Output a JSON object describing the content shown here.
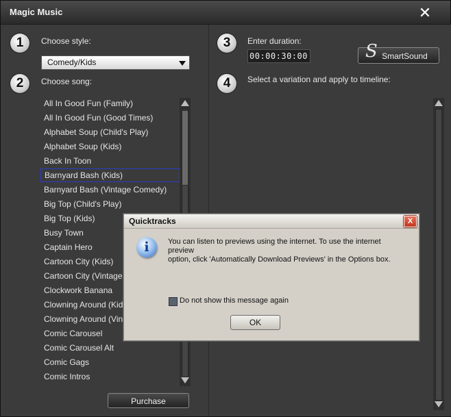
{
  "window": {
    "title": "Magic Music"
  },
  "steps": {
    "one": "1",
    "two": "2",
    "three": "3",
    "four": "4"
  },
  "labels": {
    "choose_style": "Choose style:",
    "choose_song": "Choose song:",
    "enter_duration": "Enter duration:",
    "select_variation": "Select a variation and apply to timeline:"
  },
  "style_select": {
    "value": "Comedy/Kids"
  },
  "duration": {
    "value": "00:00:30:00"
  },
  "buttons": {
    "smartsound": "SmartSound",
    "purchase": "Purchase"
  },
  "songs": [
    "All In Good Fun (Family)",
    "All In Good Fun (Good Times)",
    "Alphabet Soup (Child's Play)",
    "Alphabet Soup (Kids)",
    "Back In Toon",
    "Barnyard Bash (Kids)",
    "Barnyard Bash (Vintage Comedy)",
    "Big Top (Child's Play)",
    "Big Top (Kids)",
    "Busy Town",
    "Captain Hero",
    "Cartoon City (Kids)",
    "Cartoon City (Vintage Co",
    "Clockwork Banana",
    "Clowning Around (Kids)",
    "Clowning Around (Vintag",
    "Comic Carousel",
    "Comic Carousel Alt",
    "Comic Gags",
    "Comic Intros"
  ],
  "selected_song_index": 5,
  "dialog": {
    "title": "Quicktracks",
    "close": "X",
    "message_line1": "You can listen to previews using the internet. To use the internet preview",
    "message_line2": "option, click 'Automatically Download Previews' in the Options box.",
    "checkbox_label": "Do not show this message again",
    "ok": "OK"
  },
  "colors": {
    "selection_border": "#2b3cc8",
    "panel": "#3b3b3b",
    "dialog_bg": "#d4d0c8"
  }
}
